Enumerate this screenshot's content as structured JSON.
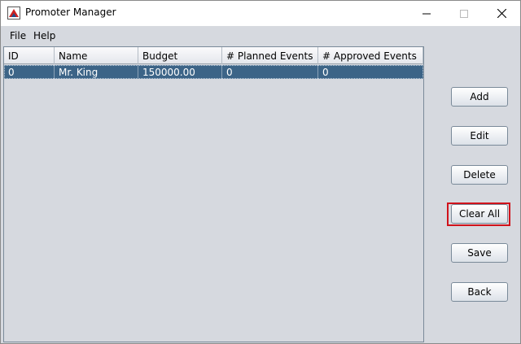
{
  "window": {
    "title": "Promoter Manager"
  },
  "menu": {
    "file": "File",
    "help": "Help"
  },
  "table": {
    "columns": [
      "ID",
      "Name",
      "Budget",
      "# Planned Events",
      "#  Approved Events"
    ],
    "rows": [
      [
        "0",
        "Mr. King",
        "150000.00",
        "0",
        "0"
      ]
    ],
    "selected_row": 0
  },
  "buttons": {
    "add": "Add",
    "edit": "Edit",
    "delete": "Delete",
    "clear_all": "Clear All",
    "save": "Save",
    "back": "Back"
  },
  "highlighted_button": "clear_all",
  "colors": {
    "selection": "#3c6487",
    "highlight_border": "#d0121b"
  }
}
